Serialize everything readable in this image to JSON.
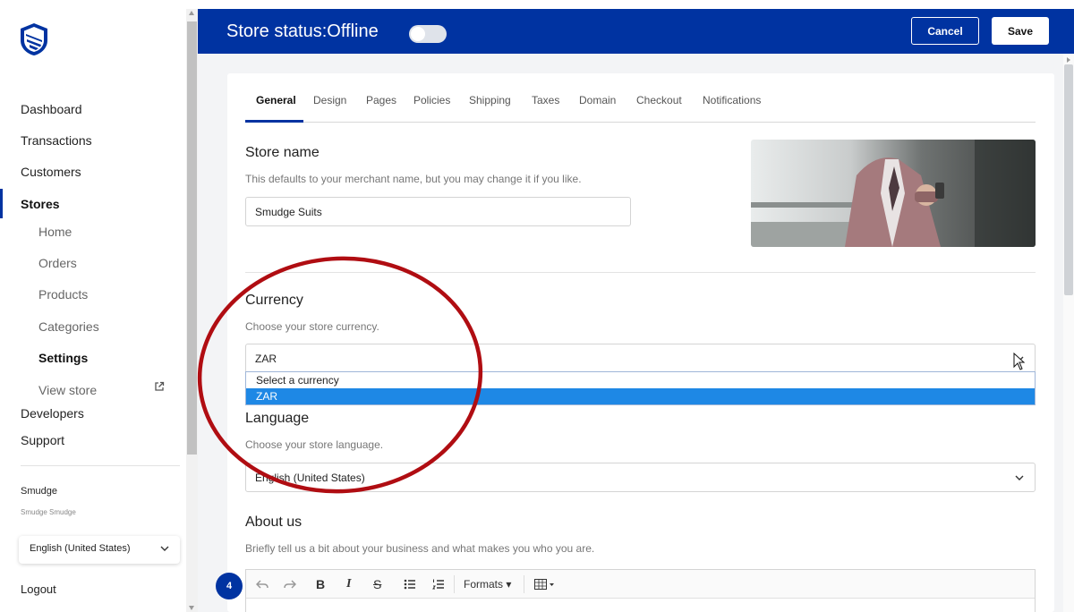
{
  "sidebar": {
    "nav": [
      "Dashboard",
      "Transactions",
      "Customers",
      "Stores"
    ],
    "stores_sub": [
      "Home",
      "Orders",
      "Products",
      "Categories",
      "Settings",
      "View store"
    ],
    "nav_bottom": [
      "Developers",
      "Support"
    ],
    "user_name": "Smudge",
    "user_sub": "Smudge Smudge",
    "language": "English (United States)",
    "logout": "Logout"
  },
  "topbar": {
    "status_title": "Store status:Offline",
    "cancel_label": "Cancel",
    "save_label": "Save"
  },
  "tabs": [
    "General",
    "Design",
    "Pages",
    "Policies",
    "Shipping",
    "Taxes",
    "Domain",
    "Checkout",
    "Notifications"
  ],
  "store_name": {
    "title": "Store name",
    "helper": "This defaults to your merchant name, but you may change it if you like.",
    "value": "Smudge Suits"
  },
  "currency": {
    "title": "Currency",
    "helper": "Choose your store currency.",
    "value": "ZAR",
    "options": [
      "Select a currency",
      "ZAR"
    ]
  },
  "language": {
    "title": "Language",
    "helper": "Choose your store language.",
    "value": "English (United States)"
  },
  "about": {
    "title": "About us",
    "helper": "Briefly tell us a bit about your business and what makes you who you are.",
    "formats_label": "Formats"
  },
  "step_badge": "4",
  "colors": {
    "brand_blue": "#0033a1",
    "annotation_red": "#b00d12",
    "highlight_blue": "#1e88e5"
  },
  "icons": [
    "bank-shield-logo",
    "external-link-icon",
    "chevron-down-icon",
    "undo-icon",
    "redo-icon",
    "bold-icon",
    "italic-icon",
    "strikethrough-icon",
    "bullet-list-icon",
    "numbered-list-icon",
    "table-icon"
  ]
}
